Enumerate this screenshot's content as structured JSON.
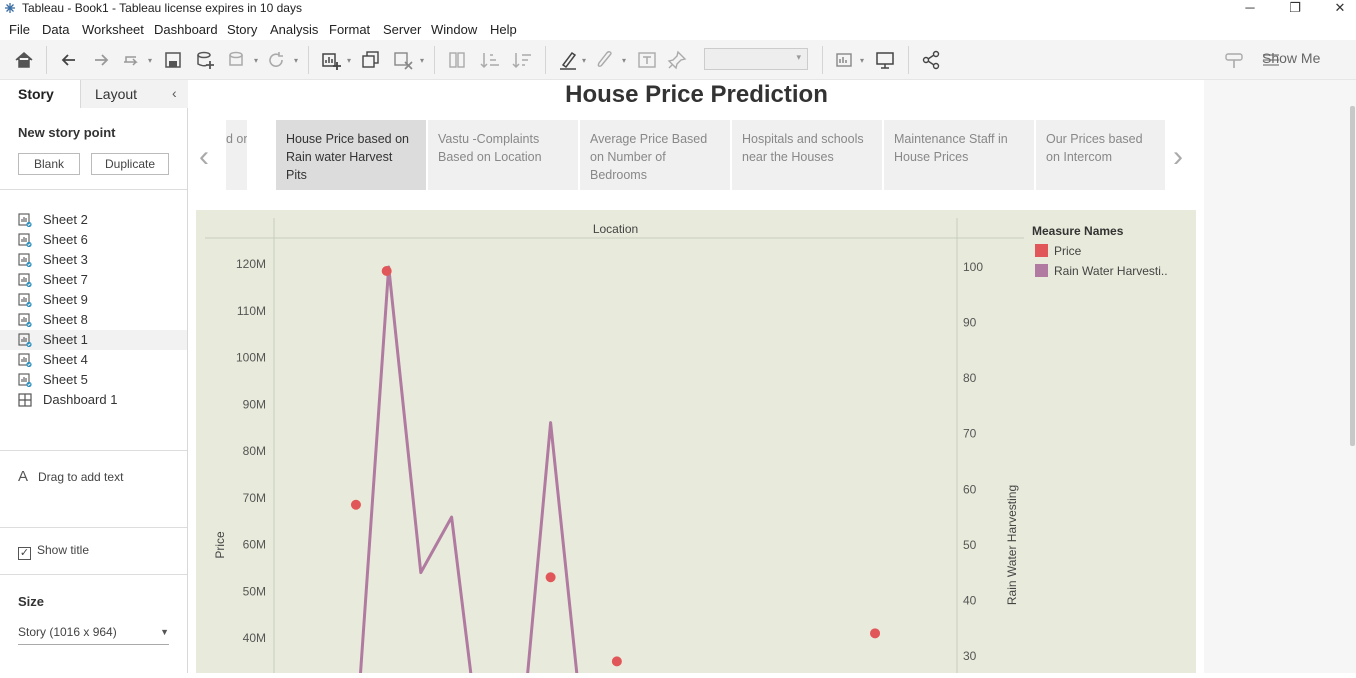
{
  "window": {
    "title": "Tableau - Book1 - Tableau license expires in 10 days"
  },
  "menu": [
    "File",
    "Data",
    "Worksheet",
    "Dashboard",
    "Story",
    "Analysis",
    "Format",
    "Server",
    "Window",
    "Help"
  ],
  "toolbar": {
    "show_me": "Show Me",
    "icons": [
      "home-icon",
      "undo-icon",
      "redo-icon",
      "replay-icon",
      "save-icon",
      "new-datasource-icon",
      "pause-updates-icon",
      "refresh-icon",
      "new-worksheet-icon",
      "duplicate-sheet-icon",
      "clear-sheet-icon",
      "swap-icon",
      "sort-ascending-icon",
      "sort-descending-icon",
      "highlight-icon",
      "annotate-icon",
      "labels-icon",
      "pin-icon",
      "fit-icon",
      "presentation-icon",
      "share-icon",
      "tooltip-icon"
    ]
  },
  "left_panel": {
    "tab_story": "Story",
    "tab_layout": "Layout",
    "new_story_point": "New story point",
    "blank_button": "Blank",
    "duplicate_button": "Duplicate",
    "sheets": [
      {
        "label": "Sheet 2",
        "active": false
      },
      {
        "label": "Sheet 6",
        "active": false
      },
      {
        "label": "Sheet 3",
        "active": false
      },
      {
        "label": "Sheet 7",
        "active": false
      },
      {
        "label": "Sheet 9",
        "active": false
      },
      {
        "label": "Sheet 8",
        "active": false
      },
      {
        "label": "Sheet 1",
        "active": true
      },
      {
        "label": "Sheet 4",
        "active": false
      },
      {
        "label": "Sheet 5",
        "active": false
      },
      {
        "label": "Dashboard 1",
        "active": false
      }
    ],
    "drag_text_icon": "A",
    "drag_text": "Drag to add text",
    "show_title": "Show title",
    "show_title_checked": true,
    "size_heading": "Size",
    "size_value": "Story (1016 x 964)"
  },
  "story": {
    "title": "House Price Prediction",
    "points": [
      {
        "label": "d on",
        "active": false
      },
      {
        "label": "House Price based on Rain water Harvest Pits",
        "active": true
      },
      {
        "label": "Vastu -Complaints Based on Location",
        "active": false
      },
      {
        "label": "Average Price Based on Number of Bedrooms",
        "active": false
      },
      {
        "label": "Hospitals and schools near the Houses",
        "active": false
      },
      {
        "label": "Maintenance Staff  in House Prices",
        "active": false
      },
      {
        "label": "Our  Prices based on Intercom",
        "active": false
      }
    ]
  },
  "chart_data": {
    "type": "line",
    "column_header": "Location",
    "ylabel": "Price",
    "y2label": "Rain Water Harvesting",
    "y_ticks": [
      "120M",
      "110M",
      "100M",
      "90M",
      "80M",
      "70M",
      "60M",
      "50M",
      "40M"
    ],
    "y2_ticks": [
      "100",
      "90",
      "80",
      "70",
      "60",
      "50",
      "40",
      "30"
    ],
    "ylim_visible": [
      34000000,
      122000000
    ],
    "y2lim_visible": [
      27,
      101
    ],
    "legend": {
      "title": "Measure Names",
      "entries": [
        {
          "name": "Price",
          "color": "#e15759"
        },
        {
          "name": "Rain Water Harvesti..",
          "color": "#b07aa1"
        }
      ]
    },
    "price_points": [
      {
        "x": 0.12,
        "value": 68500000
      },
      {
        "x": 0.165,
        "value": 118500000
      },
      {
        "x": 0.405,
        "value": 53000000
      },
      {
        "x": 0.502,
        "value": 35000000
      },
      {
        "x": 0.88,
        "value": 41000000
      }
    ],
    "rain_water_series": [
      {
        "x": 0.125,
        "value": 24
      },
      {
        "x": 0.168,
        "value": 100
      },
      {
        "x": 0.215,
        "value": 45
      },
      {
        "x": 0.26,
        "value": 55
      },
      {
        "x": 0.29,
        "value": 25
      },
      {
        "x": 0.37,
        "value": 25
      },
      {
        "x": 0.405,
        "value": 72
      },
      {
        "x": 0.445,
        "value": 25
      }
    ],
    "colors": {
      "price": "#e15759",
      "rain_water": "#b07aa1",
      "background": "#e8ebdb"
    }
  }
}
